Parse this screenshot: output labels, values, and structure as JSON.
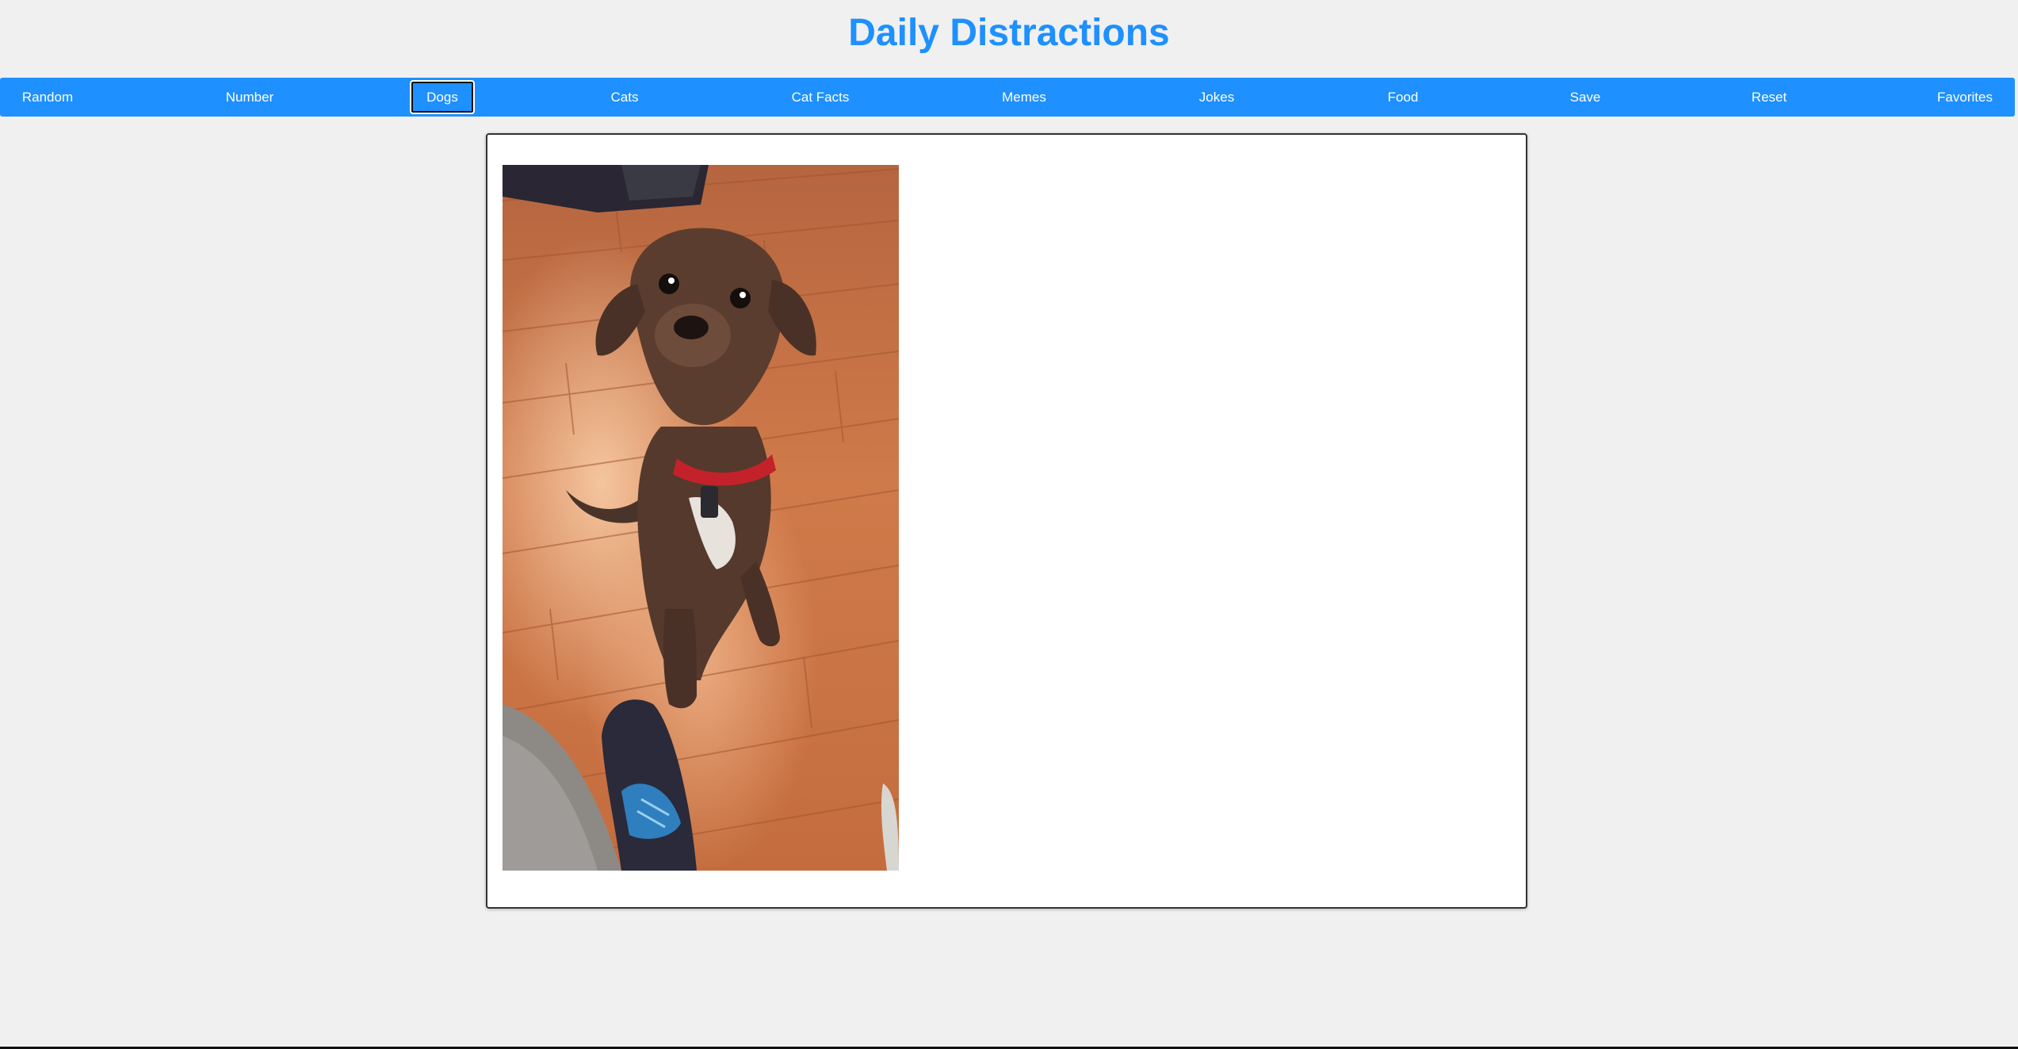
{
  "header": {
    "title": "Daily Distractions"
  },
  "colors": {
    "accent": "#1e90ff",
    "page_background": "#f0f0f0",
    "nav_text": "#ffffff"
  },
  "nav": {
    "active": "Dogs",
    "items": [
      {
        "label": "Random"
      },
      {
        "label": "Number"
      },
      {
        "label": "Dogs"
      },
      {
        "label": "Cats"
      },
      {
        "label": "Cat Facts"
      },
      {
        "label": "Memes"
      },
      {
        "label": "Jokes"
      },
      {
        "label": "Food"
      },
      {
        "label": "Save"
      },
      {
        "label": "Reset"
      },
      {
        "label": "Favorites"
      }
    ]
  }
}
